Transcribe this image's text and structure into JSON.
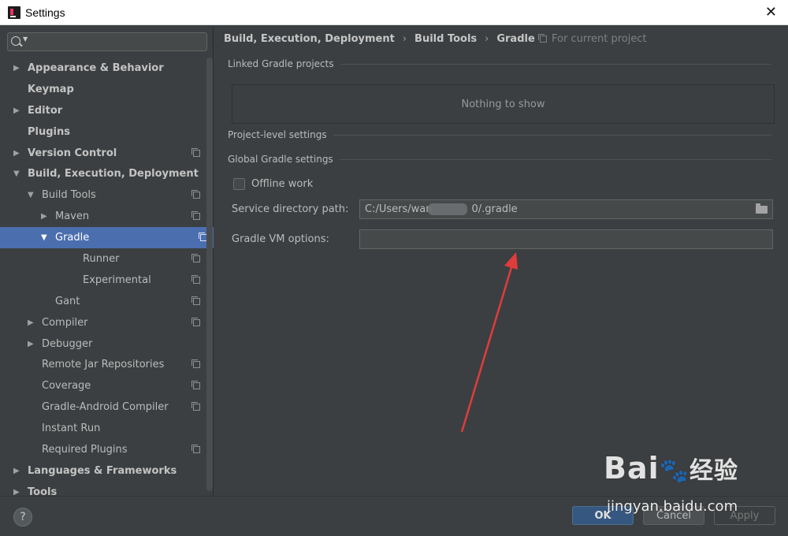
{
  "window": {
    "title": "Settings"
  },
  "search": {
    "placeholder": ""
  },
  "tree": [
    {
      "label": "Appearance & Behavior",
      "level": 0,
      "arrow": "right",
      "bold": true,
      "copy": false,
      "selected": false
    },
    {
      "label": "Keymap",
      "level": 0,
      "arrow": "none",
      "bold": true,
      "copy": false,
      "selected": false
    },
    {
      "label": "Editor",
      "level": 0,
      "arrow": "right",
      "bold": true,
      "copy": false,
      "selected": false
    },
    {
      "label": "Plugins",
      "level": 0,
      "arrow": "none",
      "bold": true,
      "copy": false,
      "selected": false
    },
    {
      "label": "Version Control",
      "level": 0,
      "arrow": "right",
      "bold": true,
      "copy": true,
      "selected": false
    },
    {
      "label": "Build, Execution, Deployment",
      "level": 0,
      "arrow": "down",
      "bold": true,
      "copy": false,
      "selected": false
    },
    {
      "label": "Build Tools",
      "level": 1,
      "arrow": "down",
      "bold": false,
      "copy": true,
      "selected": false
    },
    {
      "label": "Maven",
      "level": 2,
      "arrow": "right",
      "bold": false,
      "copy": true,
      "selected": false
    },
    {
      "label": "Gradle",
      "level": 2,
      "arrow": "down",
      "bold": false,
      "copy": true,
      "selected": true
    },
    {
      "label": "Runner",
      "level": 3,
      "arrow": "none",
      "bold": false,
      "copy": true,
      "selected": false
    },
    {
      "label": "Experimental",
      "level": 3,
      "arrow": "none",
      "bold": false,
      "copy": true,
      "selected": false
    },
    {
      "label": "Gant",
      "level": 2,
      "arrow": "none",
      "bold": false,
      "copy": true,
      "selected": false
    },
    {
      "label": "Compiler",
      "level": 1,
      "arrow": "right",
      "bold": false,
      "copy": true,
      "selected": false
    },
    {
      "label": "Debugger",
      "level": 1,
      "arrow": "right",
      "bold": false,
      "copy": false,
      "selected": false
    },
    {
      "label": "Remote Jar Repositories",
      "level": 1,
      "arrow": "none",
      "bold": false,
      "copy": true,
      "selected": false
    },
    {
      "label": "Coverage",
      "level": 1,
      "arrow": "none",
      "bold": false,
      "copy": true,
      "selected": false
    },
    {
      "label": "Gradle-Android Compiler",
      "level": 1,
      "arrow": "none",
      "bold": false,
      "copy": true,
      "selected": false
    },
    {
      "label": "Instant Run",
      "level": 1,
      "arrow": "none",
      "bold": false,
      "copy": false,
      "selected": false
    },
    {
      "label": "Required Plugins",
      "level": 1,
      "arrow": "none",
      "bold": false,
      "copy": true,
      "selected": false
    },
    {
      "label": "Languages & Frameworks",
      "level": 0,
      "arrow": "right",
      "bold": true,
      "copy": false,
      "selected": false
    },
    {
      "label": "Tools",
      "level": 0,
      "arrow": "right",
      "bold": true,
      "copy": false,
      "selected": false
    }
  ],
  "breadcrumb": [
    "Build, Execution, Deployment",
    "Build Tools",
    "Gradle"
  ],
  "for_project": "For current project",
  "sections": {
    "linked": "Linked Gradle projects",
    "empty": "Nothing to show",
    "project_level": "Project-level settings",
    "global": "Global Gradle settings"
  },
  "offline": {
    "label": "Offline work",
    "checked": false
  },
  "service_dir": {
    "label": "Service directory path:",
    "value_prefix": "C:/Users/wan",
    "value_suffix": "0/.gradle"
  },
  "vm_options": {
    "label": "Gradle VM options:",
    "value": ""
  },
  "buttons": {
    "help": "?",
    "ok": "OK",
    "cancel": "Cancel",
    "apply": "Apply"
  },
  "watermark": {
    "logo": "Bai",
    "logo_cn": "经验",
    "url": "jingyan.baidu.com"
  },
  "colors": {
    "selection": "#4b6eaf",
    "annotation_arrow": "#e03c3c"
  }
}
